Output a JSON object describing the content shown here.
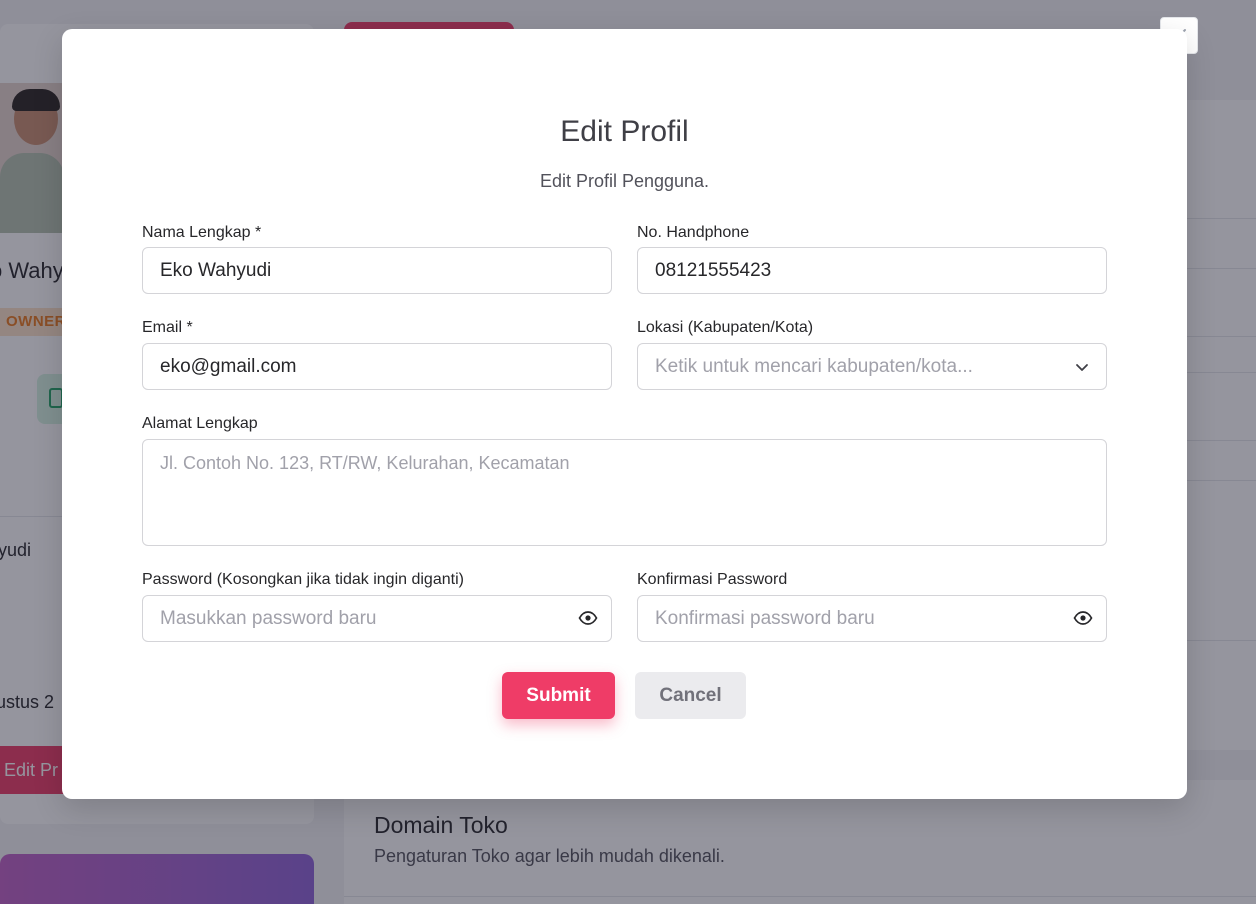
{
  "background": {
    "profile_name": "o Wahy",
    "role_badge": "OWNER",
    "username_snippet": "yudi",
    "date_snippet": "ustus 2",
    "edit_button": "Edit Pr",
    "domain_title": "Domain Toko",
    "domain_subtitle": "Pengaturan Toko agar lebih mudah dikenali."
  },
  "modal": {
    "title": "Edit Profil",
    "subtitle": "Edit Profil Pengguna.",
    "close_icon": "close-icon",
    "fields": {
      "full_name": {
        "label": "Nama Lengkap *",
        "value": "Eko Wahyudi"
      },
      "phone": {
        "label": "No. Handphone",
        "value": "08121555423"
      },
      "email": {
        "label": "Email *",
        "value": "eko@gmail.com"
      },
      "location": {
        "label": "Lokasi (Kabupaten/Kota)",
        "placeholder": "Ketik untuk mencari kabupaten/kota...",
        "icon": "chevron-down-icon"
      },
      "address": {
        "label": "Alamat Lengkap",
        "placeholder": "Jl. Contoh No. 123, RT/RW, Kelurahan, Kecamatan"
      },
      "password": {
        "label": "Password (Kosongkan jika tidak ingin diganti)",
        "placeholder": "Masukkan password baru",
        "icon": "eye-icon"
      },
      "confirm_password": {
        "label": "Konfirmasi Password",
        "placeholder": "Konfirmasi password baru",
        "icon": "eye-icon"
      }
    },
    "buttons": {
      "submit": "Submit",
      "cancel": "Cancel"
    }
  },
  "colors": {
    "accent": "#ef3c67",
    "overlay": "#1e1e30",
    "cancel_bg": "#ebebee"
  }
}
